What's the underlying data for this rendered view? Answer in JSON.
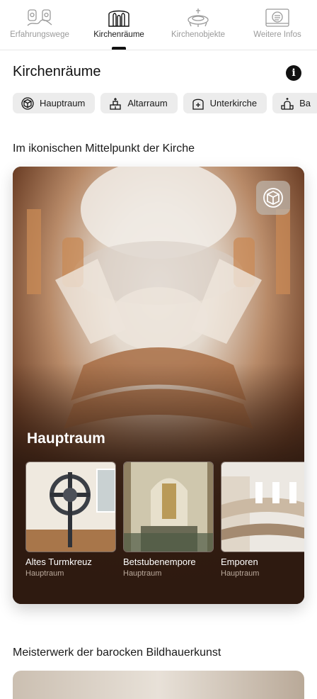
{
  "tabs": [
    {
      "label": "Erfahrungswege",
      "icon": "people-path-icon",
      "active": false
    },
    {
      "label": "Kirchenräume",
      "icon": "church-interior-icon",
      "active": true
    },
    {
      "label": "Kirchenobjekte",
      "icon": "chandelier-icon",
      "active": false
    },
    {
      "label": "Weitere Infos",
      "icon": "book-icon",
      "active": false
    }
  ],
  "page": {
    "title": "Kirchenräume",
    "info_icon": "info-icon",
    "info_glyph": "i"
  },
  "chips": [
    {
      "label": "Hauptraum",
      "icon": "cube-icon"
    },
    {
      "label": "Altarraum",
      "icon": "altar-icon"
    },
    {
      "label": "Unterkirche",
      "icon": "crypt-icon"
    },
    {
      "label": "Ba",
      "icon": "church-icon"
    }
  ],
  "section1": {
    "heading": "Im ikonischen Mittelpunkt der Kirche",
    "card": {
      "title": "Hauptraum",
      "view_icon": "cube-3d-icon",
      "items": [
        {
          "title": "Altes Turmkreuz",
          "subtitle": "Hauptraum"
        },
        {
          "title": "Betstubenempore",
          "subtitle": "Hauptraum"
        },
        {
          "title": "Emporen",
          "subtitle": "Hauptraum"
        }
      ]
    }
  },
  "section2": {
    "heading": "Meisterwerk der barocken Bildhauerkunst"
  },
  "colors": {
    "accent": "#111111",
    "card_bg": "#2e1a10",
    "chip_bg": "#ececec",
    "muted": "#9a9a9a"
  }
}
